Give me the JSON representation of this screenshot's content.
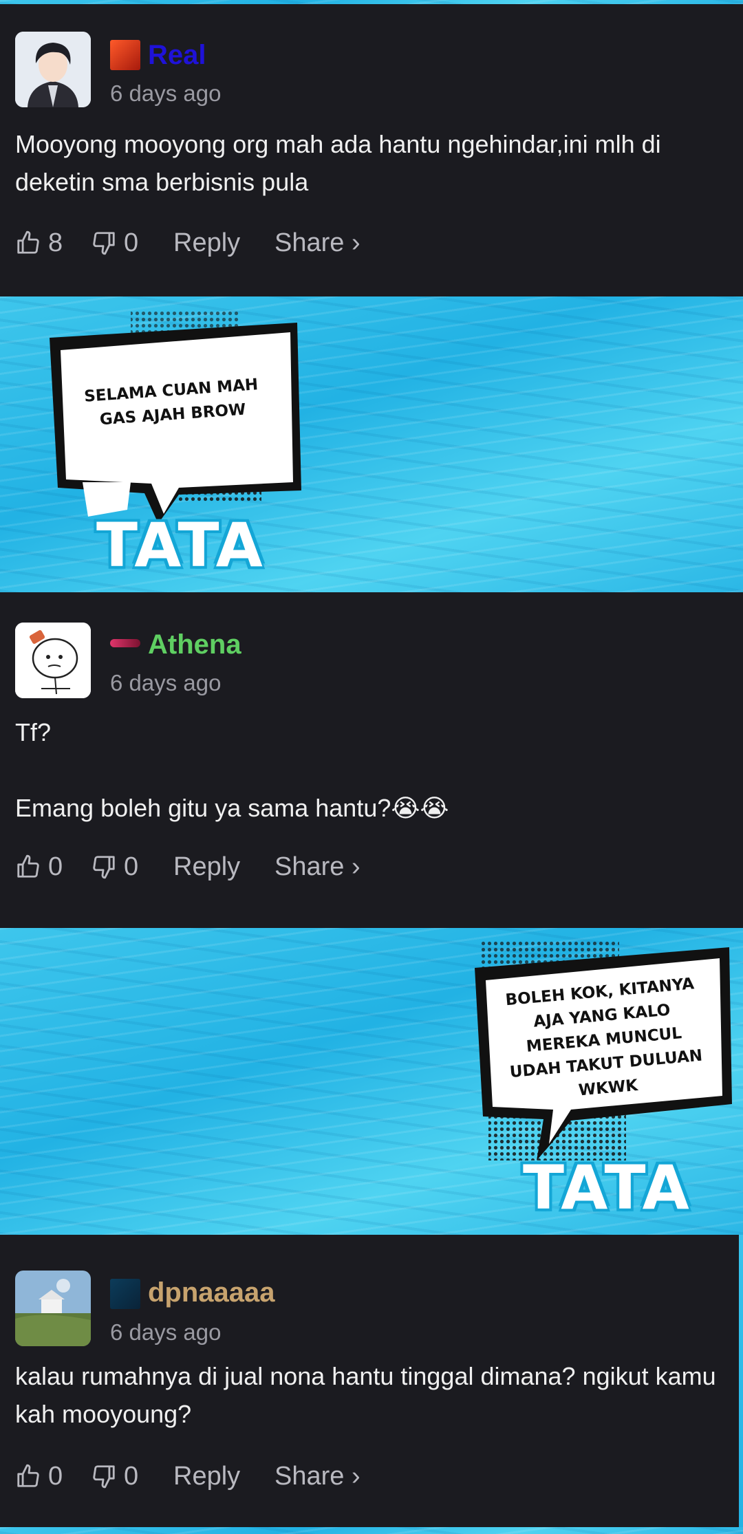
{
  "comments": [
    {
      "username": "Real",
      "username_color": "#1f12d8",
      "time": "6 days ago",
      "text": "Mooyong mooyong org mah ada hantu ngehindar,ini mlh di deketin sma berbisnis pula",
      "likes": "8",
      "dislikes": "0",
      "reply_label": "Reply",
      "share_label": "Share ›"
    },
    {
      "username": "Athena",
      "username_color": "#5fcf62",
      "time": "6 days ago",
      "text": "Tf?\n\nEmang boleh gitu ya sama hantu?😭😭",
      "likes": "0",
      "dislikes": "0",
      "reply_label": "Reply",
      "share_label": "Share ›"
    },
    {
      "username": "dpnaaaaa",
      "username_color": "#c7a36e",
      "time": "6 days ago",
      "text": "kalau rumahnya di jual nona hantu tinggal dimana? ngikut kamu kah mooyoung?",
      "likes": "0",
      "dislikes": "0",
      "reply_label": "Reply",
      "share_label": "Share ›"
    }
  ],
  "panels": [
    {
      "speech": "SELAMA CUAN MAH\nGAS AJAH BROW",
      "speaker": "TATA"
    },
    {
      "speech": "BOLEH KOK, KITANYA\nAJA YANG KALO\nMEREKA MUNCUL\nUDAH TAKUT DULUAN\nWKWK",
      "speaker": "TATA"
    }
  ],
  "icons": {
    "like": "thumbs-up-icon",
    "dislike": "thumbs-down-icon"
  }
}
